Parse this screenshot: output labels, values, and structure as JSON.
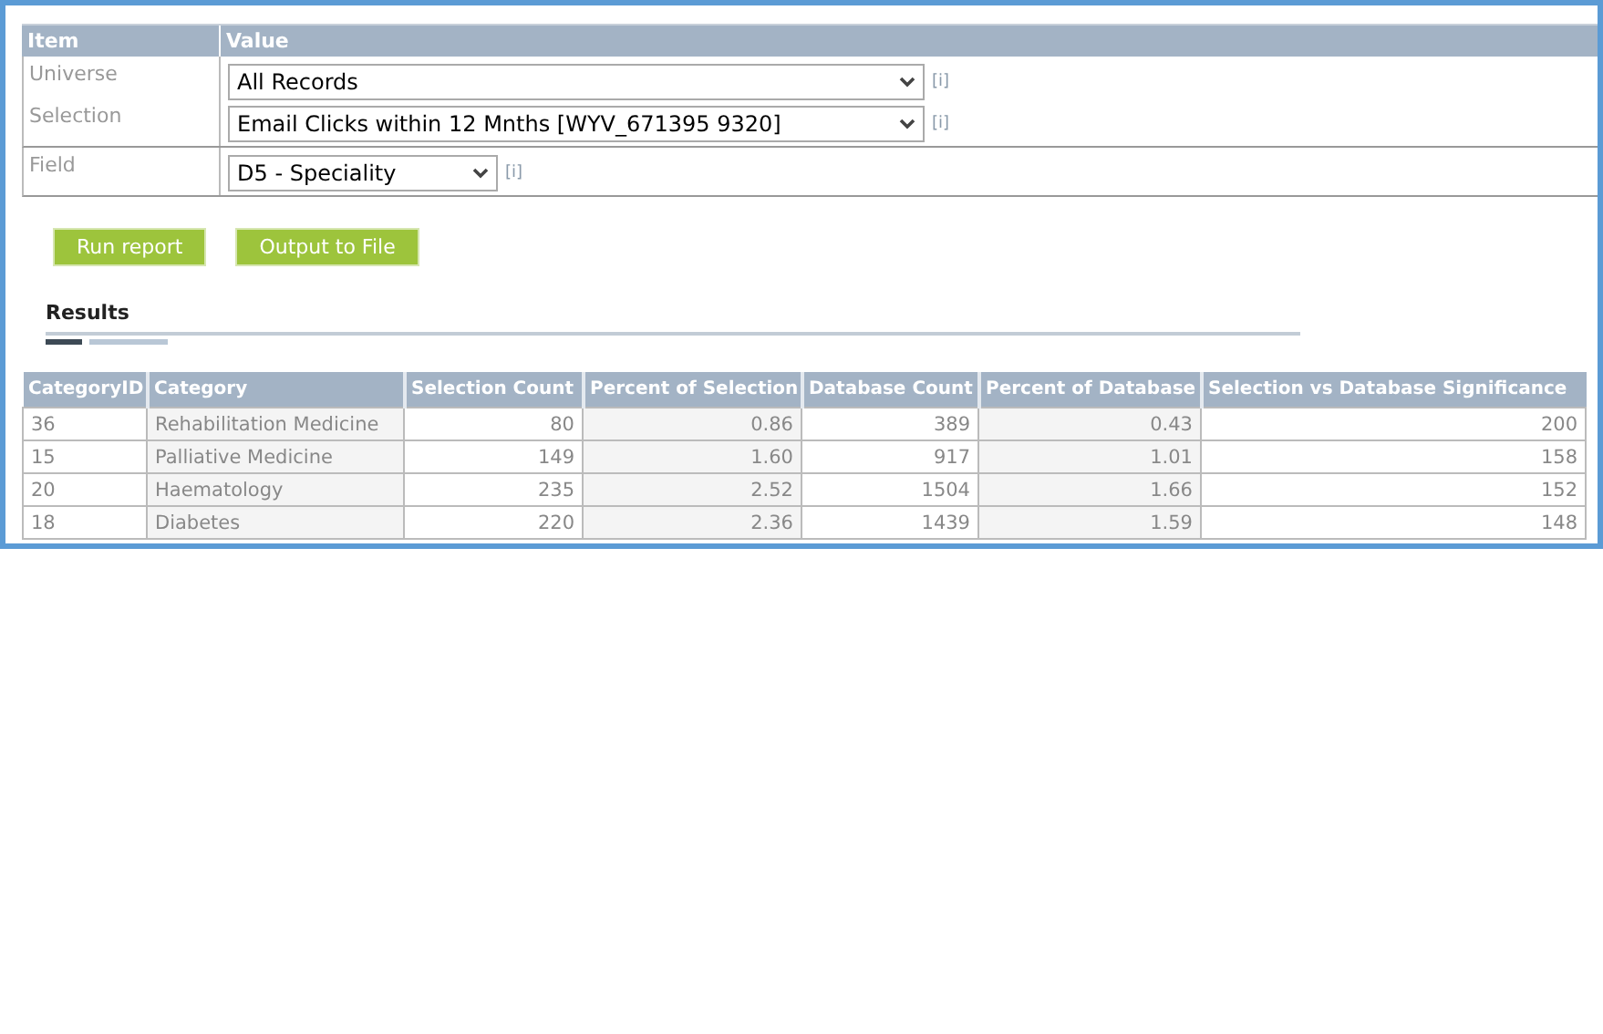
{
  "parameters": {
    "columns": [
      "Item",
      "Value"
    ],
    "groups": [
      {
        "kind": "source",
        "rows": [
          {
            "label": "Universe",
            "value": "All Records",
            "info": "[i]"
          },
          {
            "label": "Selection",
            "value": "Email Clicks within 12 Mnths [WYV_671395 9320]",
            "info": "[i]"
          }
        ]
      },
      {
        "kind": "field",
        "rows": [
          {
            "label": "Field",
            "value": "D5 - Speciality",
            "info": "[i]"
          }
        ]
      }
    ]
  },
  "buttons": [
    "Run report",
    "Output to File"
  ],
  "results": {
    "title": "Results",
    "columns": [
      "CategoryID",
      "Category",
      "Selection Count",
      "Percent of Selection",
      "Database Count",
      "Percent of Database",
      "Selection vs Database Significance"
    ],
    "rows": [
      [
        "36",
        "Rehabilitation Medicine",
        "80",
        "0.86",
        "389",
        "0.43",
        "200"
      ],
      [
        "15",
        "Palliative Medicine",
        "149",
        "1.60",
        "917",
        "1.01",
        "158"
      ],
      [
        "20",
        "Haematology",
        "235",
        "2.52",
        "1504",
        "1.66",
        "152"
      ],
      [
        "18",
        "Diabetes",
        "220",
        "2.36",
        "1439",
        "1.59",
        "148"
      ]
    ]
  }
}
